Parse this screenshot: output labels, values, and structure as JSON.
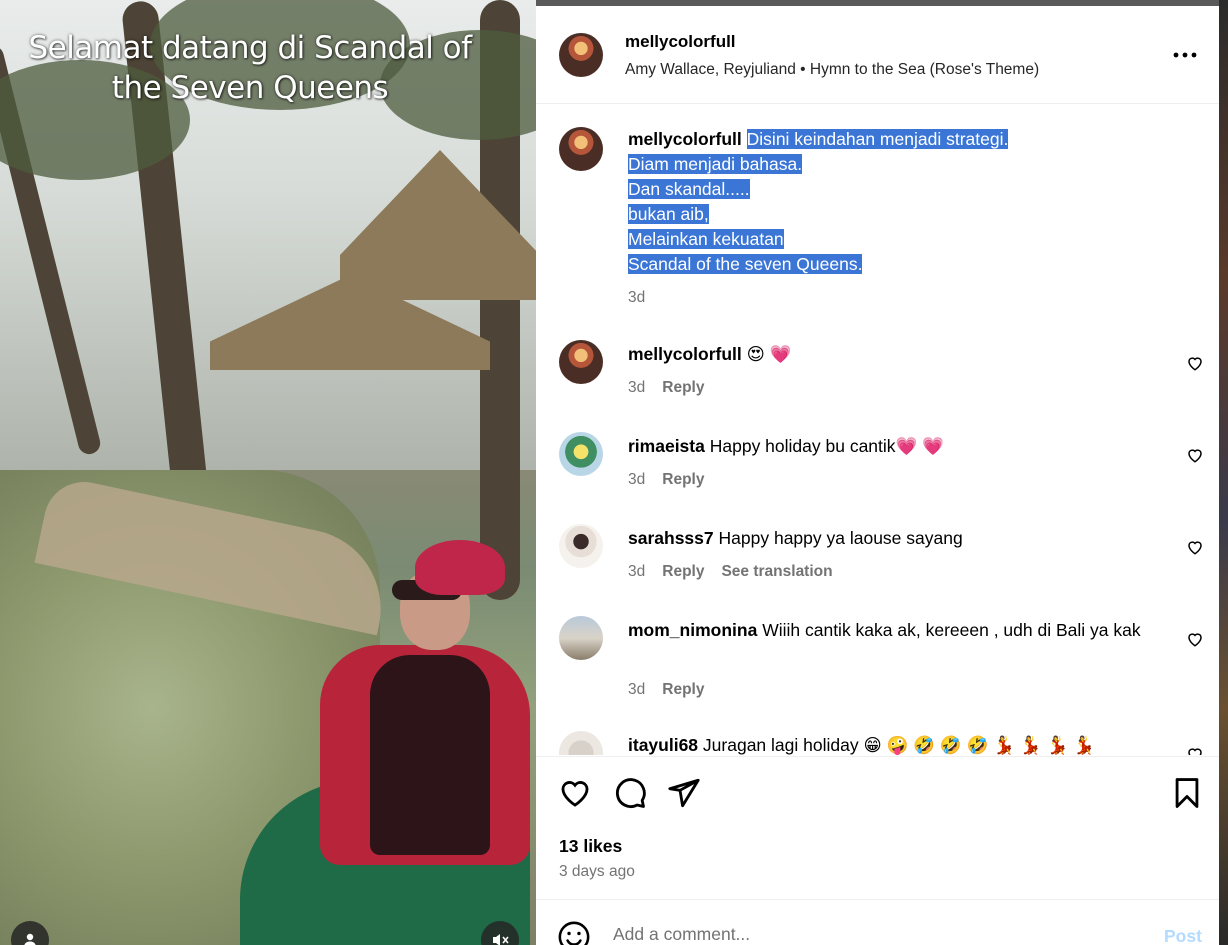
{
  "media": {
    "caption_line1": "Selamat datang  di Scandal of",
    "caption_line2": "the Seven Queens"
  },
  "header": {
    "username": "mellycolorfull",
    "music": "Amy Wallace, Reyjuliand • Hymn to the Sea (Rose's Theme)",
    "more_icon": "more-horizontal-icon"
  },
  "post_caption": {
    "username": "mellycolorfull",
    "lines": [
      "Disini keindahan menjadi strategi.",
      "Diam menjadi bahasa.",
      "Dan skandal.....",
      "bukan aib,",
      "Melainkan kekuatan",
      "Scandal of the seven Queens."
    ],
    "time": "3d"
  },
  "comments": [
    {
      "username": "mellycolorfull",
      "text": "😍 💗",
      "time": "3d",
      "reply": "Reply"
    },
    {
      "username": "rimaeista",
      "text": "Happy holiday bu cantik💗 💗",
      "time": "3d",
      "reply": "Reply"
    },
    {
      "username": "sarahsss7",
      "text": "Happy happy ya laouse sayang",
      "time": "3d",
      "reply": "Reply",
      "translate": "See translation"
    },
    {
      "username": "mom_nimonina",
      "text": "Wiiih cantik kaka ak, kereeen , udh di Bali ya kak",
      "time": "3d",
      "reply": "Reply"
    },
    {
      "username": "itayuli68",
      "text": "Juragan lagi holiday 😁 🤪 🤣 🤣 🤣 💃 💃 💃 💃"
    }
  ],
  "stats": {
    "likes": "13 likes",
    "posted": "3 days ago"
  },
  "add_comment": {
    "placeholder": "Add a comment...",
    "post_label": "Post"
  },
  "colors": {
    "selection": "#3b76d6",
    "post_disabled": "#b3dbff",
    "muted_text": "#737373"
  }
}
